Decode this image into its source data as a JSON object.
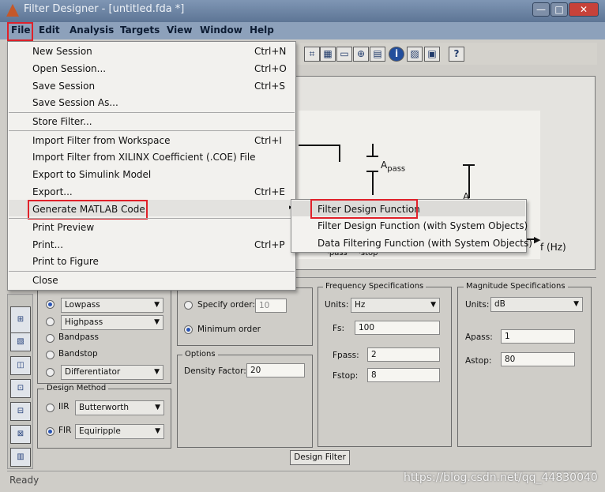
{
  "window": {
    "title": "Filter Designer - [untitled.fda *]",
    "controls": [
      "—",
      "□",
      "✕"
    ]
  },
  "menubar": [
    "File",
    "Edit",
    "Analysis",
    "Targets",
    "View",
    "Window",
    "Help"
  ],
  "toolbar": {
    "icons": [
      "design-filter-icon",
      "magnitude-icon",
      "phase-icon",
      "group-delay-icon",
      "pole-zero-icon",
      "filter-info-icon",
      "impulse-icon",
      "step-icon",
      "whats-this-icon"
    ],
    "glyphs": [
      "⌗",
      "▦",
      "▭",
      "⊕",
      "▤",
      "i",
      "▨",
      "▣",
      "?"
    ]
  },
  "file_menu": {
    "items": [
      {
        "label": "New Session",
        "shortcut": "Ctrl+N"
      },
      {
        "label": "Open Session...",
        "shortcut": "Ctrl+O"
      },
      {
        "label": "Save Session",
        "shortcut": "Ctrl+S"
      },
      {
        "label": "Save Session As...",
        "shortcut": ""
      },
      {
        "label": "Store Filter...",
        "shortcut": ""
      },
      {
        "label": "Import Filter from Workspace",
        "shortcut": "Ctrl+I"
      },
      {
        "label": "Import Filter from XILINX Coefficient (.COE) File",
        "shortcut": ""
      },
      {
        "label": "Export to Simulink Model",
        "shortcut": ""
      },
      {
        "label": "Export...",
        "shortcut": "Ctrl+E"
      },
      {
        "label": "Generate MATLAB Code",
        "shortcut": "▸"
      },
      {
        "label": "Print Preview",
        "shortcut": ""
      },
      {
        "label": "Print...",
        "shortcut": "Ctrl+P"
      },
      {
        "label": "Print to Figure",
        "shortcut": ""
      },
      {
        "label": "Close",
        "shortcut": ""
      }
    ]
  },
  "submenu": {
    "items": [
      "Filter Design Function",
      "Filter Design Function (with System Objects)",
      "Data Filtering Function (with System Objects)"
    ]
  },
  "plot": {
    "apass_base": "A",
    "apass_sub": "pass",
    "astop_base": "A",
    "f_base1": "F",
    "f_sub1": "pass",
    "f_base2": "F",
    "f_sub2": "stop",
    "xlabel": "f (Hz)"
  },
  "response_type": {
    "options": [
      "Lowpass",
      "Highpass",
      "Bandpass",
      "Bandstop",
      "Differentiator"
    ]
  },
  "design_method": {
    "title": "Design Method",
    "iir_label": "IIR",
    "iir_value": "Butterworth",
    "fir_label": "FIR",
    "fir_value": "Equiripple"
  },
  "filter_order": {
    "specify_label": "Specify order:",
    "specify_value": "10",
    "minimum_label": "Minimum order"
  },
  "options": {
    "title": "Options",
    "density_label": "Density Factor:",
    "density_value": "20"
  },
  "freq_spec": {
    "title": "Frequency Specifications",
    "units_label": "Units:",
    "units_value": "Hz",
    "fs_label": "Fs:",
    "fs_value": "100",
    "fpass_label": "Fpass:",
    "fpass_value": "2",
    "fstop_label": "Fstop:",
    "fstop_value": "8"
  },
  "mag_spec": {
    "title": "Magnitude Specifications",
    "units_label": "Units:",
    "units_value": "dB",
    "apass_label": "Apass:",
    "apass_value": "1",
    "astop_label": "Astop:",
    "astop_value": "80"
  },
  "design_button": "Design Filter",
  "status": "Ready",
  "watermark": "https://blog.csdn.net/qq_44830040",
  "left_icons": [
    "⊞",
    "▧",
    "◫",
    "⊡",
    "⊟",
    "⊠",
    "▥"
  ],
  "colors": {
    "highlight_red": "#e0212a",
    "title_bar": "#6b82a3",
    "menu_bg": "#f2f1ee"
  }
}
